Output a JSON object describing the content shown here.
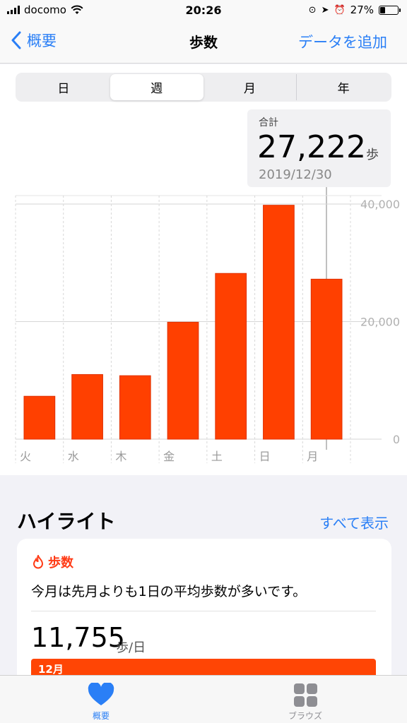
{
  "status": {
    "carrier": "docomo",
    "time": "20:26",
    "battery": "27%",
    "battery_level": 0.27
  },
  "nav": {
    "back_label": "概要",
    "title": "歩数",
    "add_label": "データを追加"
  },
  "segments": [
    {
      "label": "日",
      "active": false
    },
    {
      "label": "週",
      "active": true
    },
    {
      "label": "月",
      "active": false
    },
    {
      "label": "年",
      "active": false
    }
  ],
  "tooltip": {
    "label": "合計",
    "value": "27,222",
    "unit": "歩",
    "date": "2019/12/30"
  },
  "chart_data": {
    "type": "bar",
    "categories": [
      "火",
      "水",
      "木",
      "金",
      "土",
      "日",
      "月"
    ],
    "values": [
      7300,
      11000,
      10800,
      19900,
      28200,
      39800,
      27222
    ],
    "ylim": [
      0,
      40000
    ],
    "yticks": [
      0,
      20000,
      40000
    ],
    "ytick_labels": [
      "0",
      "20,000",
      "40,000"
    ],
    "bar_color": "#ff4000",
    "grid": true,
    "axis_position": "right"
  },
  "highlights": {
    "title": "ハイライト",
    "show_all": "すべて表示",
    "card": {
      "category": "歩数",
      "text": "今月は先月よりも1日の平均歩数が多いです。",
      "value": "11,755",
      "unit": "歩/日",
      "bar_label": "12月"
    }
  },
  "tabs": {
    "summary": "概要",
    "browse": "ブラウズ"
  },
  "colors": {
    "accent": "#2a7ff6",
    "steps": "#ff4000",
    "highlight_bar": "#ff4505"
  }
}
